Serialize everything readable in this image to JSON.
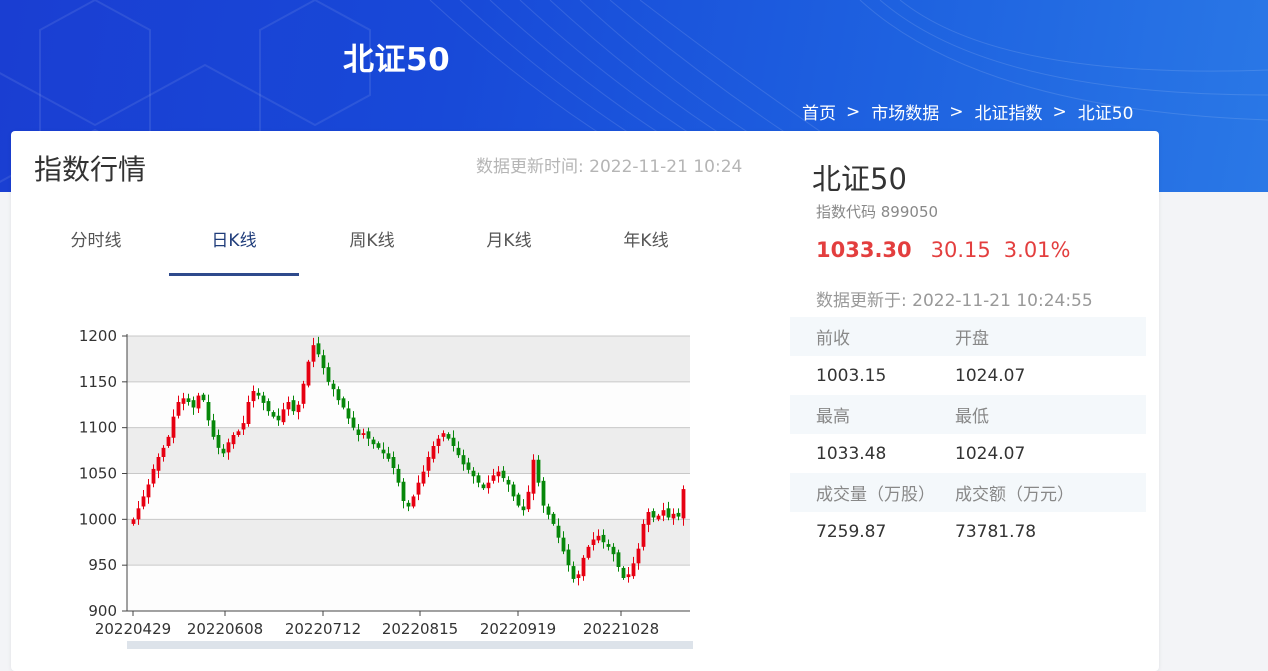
{
  "header": {
    "title": "北证50",
    "breadcrumb": [
      "首页",
      "市场数据",
      "北证指数",
      "北证50"
    ],
    "sep": ">"
  },
  "quote_section": {
    "title": "指数行情",
    "update_time": "数据更新时间: 2022-11-21 10:24",
    "tabs": [
      {
        "label": "分时线",
        "active": false
      },
      {
        "label": "日K线",
        "active": true
      },
      {
        "label": "周K线",
        "active": false
      },
      {
        "label": "月K线",
        "active": false
      },
      {
        "label": "年K线",
        "active": false
      }
    ]
  },
  "info": {
    "name": "北证50",
    "code": "指数代码 899050",
    "price": "1033.30",
    "change": "30.15",
    "change_pct": "3.01%",
    "updated": "数据更新于: 2022-11-21 10:24:55",
    "stats": [
      {
        "label": "前收",
        "value": "1003.15"
      },
      {
        "label": "开盘",
        "value": "1024.07"
      },
      {
        "label": "最高",
        "value": "1033.48"
      },
      {
        "label": "最低",
        "value": "1024.07"
      },
      {
        "label": "成交量（万股）",
        "value": "7259.87"
      },
      {
        "label": "成交额（万元）",
        "value": "73781.78"
      }
    ]
  },
  "colors": {
    "up": "#e60012",
    "down": "#07870a",
    "accent": "#2e4a8c"
  },
  "chart_data": {
    "type": "candlestick",
    "ylim": [
      900,
      1200
    ],
    "yticks": [
      900,
      950,
      1000,
      1050,
      1100,
      1150,
      1200
    ],
    "xtick_labels": [
      "20220429",
      "20220608",
      "20220712",
      "20220815",
      "20220919",
      "20221028"
    ],
    "closes": [
      1000,
      1012,
      1025,
      1038,
      1055,
      1068,
      1078,
      1090,
      1112,
      1128,
      1132,
      1128,
      1122,
      1135,
      1130,
      1108,
      1090,
      1078,
      1072,
      1084,
      1092,
      1096,
      1105,
      1128,
      1140,
      1135,
      1127,
      1118,
      1112,
      1108,
      1120,
      1128,
      1118,
      1125,
      1148,
      1172,
      1190,
      1180,
      1165,
      1150,
      1142,
      1130,
      1122,
      1110,
      1100,
      1092,
      1094,
      1088,
      1082,
      1078,
      1072,
      1066,
      1056,
      1040,
      1020,
      1014,
      1025,
      1040,
      1052,
      1068,
      1080,
      1088,
      1094,
      1088,
      1080,
      1070,
      1060,
      1054,
      1047,
      1040,
      1034,
      1040,
      1048,
      1052,
      1045,
      1038,
      1025,
      1015,
      1010,
      1030,
      1065,
      1040,
      1015,
      1005,
      995,
      980,
      965,
      950,
      935,
      940,
      958,
      970,
      978,
      982,
      975,
      970,
      962,
      948,
      936,
      940,
      952,
      968,
      995,
      1008,
      1002,
      1004,
      1010,
      1002,
      1006,
      1003,
      1033
    ]
  }
}
